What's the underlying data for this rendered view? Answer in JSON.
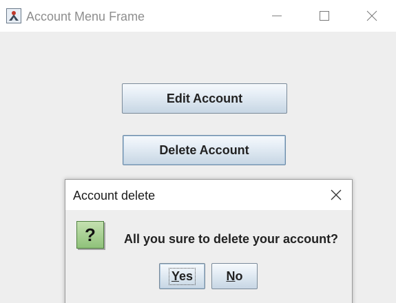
{
  "window": {
    "title": "Account Menu Frame",
    "icon": "java-app-icon",
    "controls": [
      "minimize",
      "maximize",
      "close"
    ]
  },
  "main": {
    "edit_label": "Edit Account",
    "delete_label": "Delete Account"
  },
  "dialog": {
    "title": "Account delete",
    "icon": "question-icon",
    "icon_glyph": "?",
    "message": "All you sure to delete your account?",
    "yes_label": "Yes",
    "yes_mnemonic": "Y",
    "yes_rest": "es",
    "no_label": "No",
    "no_mnemonic": "N",
    "no_rest": "o"
  },
  "colors": {
    "background": "#eeeeee",
    "titlebar": "#ffffff",
    "button_border": "#7a8a99",
    "question_icon": "#8fc27a"
  }
}
